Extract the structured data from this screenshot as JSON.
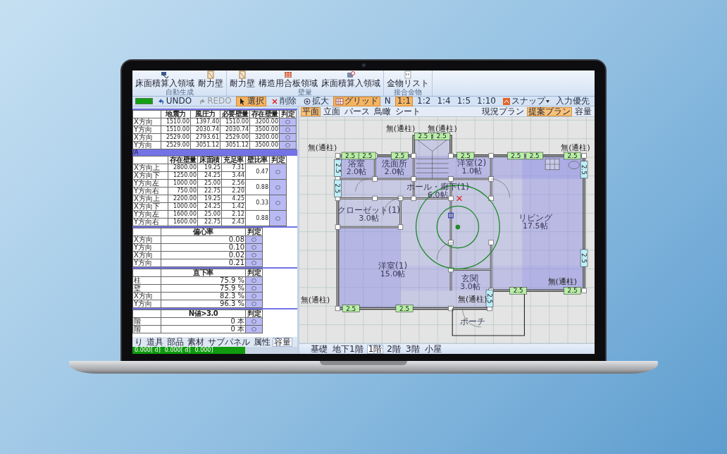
{
  "ribbon": {
    "groups": [
      {
        "label": "自動生成",
        "buttons": [
          {
            "label": "床面積算入領域"
          },
          {
            "label": "耐力壁"
          }
        ]
      },
      {
        "label": "壁量",
        "buttons": [
          {
            "label": "耐力壁"
          },
          {
            "label": "構造用合板領域"
          },
          {
            "label": "床面積算入領域"
          }
        ]
      },
      {
        "label": "接合金物",
        "buttons": [
          {
            "label": "金物リスト"
          }
        ]
      }
    ]
  },
  "toolbar": {
    "progress": {
      "level": 1
    },
    "items": [
      {
        "kind": "button",
        "label": "UNDO",
        "selected": false,
        "disabled": false
      },
      {
        "kind": "button",
        "label": "REDO",
        "selected": false,
        "disabled": true
      },
      {
        "kind": "button",
        "label": "選択",
        "selected": true,
        "disabled": false
      },
      {
        "kind": "button",
        "label": "削除",
        "selected": false,
        "disabled": false
      },
      {
        "kind": "button",
        "label": "拡大",
        "selected": false,
        "disabled": false
      },
      {
        "kind": "button",
        "label": "グリッド",
        "selected": true,
        "disabled": false
      },
      {
        "kind": "button",
        "label": "N",
        "selected": false,
        "disabled": false
      },
      {
        "kind": "button",
        "label": "1:1",
        "selected": true,
        "disabled": false
      },
      {
        "kind": "button",
        "label": "1:2",
        "selected": false,
        "disabled": false
      },
      {
        "kind": "button",
        "label": "1:4",
        "selected": false,
        "disabled": false
      },
      {
        "kind": "button",
        "label": "1:5",
        "selected": false,
        "disabled": false
      },
      {
        "kind": "button",
        "label": "1:10",
        "selected": false,
        "disabled": false
      },
      {
        "kind": "menu",
        "label": "スナップ",
        "selected": false,
        "disabled": false
      },
      {
        "kind": "button",
        "label": "入力優先",
        "selected": false,
        "disabled": false
      }
    ]
  },
  "check_panel": {
    "sections": [
      {
        "kind": "six",
        "columns": [
          "",
          "地震力",
          "風圧力",
          "必要壁量",
          "存在壁量",
          "判定"
        ],
        "rows": [
          {
            "cells": [
              "X方向",
              "1510.00",
              "1397.40",
              "1510.00",
              "3200.00",
              "○"
            ]
          },
          {
            "cells": [
              "Y方向",
              "1510.00",
              "2030.74",
              "2030.74",
              "3500.00",
              "○"
            ]
          },
          {
            "cells": [
              "X方向",
              "2529.00",
              "2793.61",
              "2529.00",
              "3200.00",
              "○"
            ]
          },
          {
            "cells": [
              "Y方向",
              "2529.00",
              "3051.12",
              "3051.12",
              "3500.00",
              "○"
            ]
          }
        ]
      },
      {
        "kind": "wall",
        "band": "/A",
        "columns": [
          "",
          "存在壁量",
          "床面積",
          "充足率",
          "壁比率",
          "判定"
        ],
        "rows": [
          {
            "cells": [
              "X方向上",
              "2800.00",
              "19.25",
              "7.31"
            ],
            "merged": [
              "0.47",
              "○"
            ]
          },
          {
            "cells": [
              "X方向下",
              "1250.00",
              "24.25",
              "3.44"
            ]
          },
          {
            "cells": [
              "Y方向左",
              "1000.00",
              "25.00",
              "2.56"
            ],
            "merged": [
              "0.88",
              "○"
            ]
          },
          {
            "cells": [
              "Y方向右",
              "750.00",
              "22.75",
              "2.20"
            ]
          },
          {
            "cells": [
              "X方向上",
              "2200.00",
              "19.25",
              "4.25"
            ],
            "merged": [
              "0.33",
              "○"
            ]
          },
          {
            "cells": [
              "X方向下",
              "1000.00",
              "24.25",
              "1.42"
            ]
          },
          {
            "cells": [
              "Y方向左",
              "1600.00",
              "25.00",
              "2.12"
            ],
            "merged": [
              "0.88",
              "○"
            ]
          },
          {
            "cells": [
              "Y方向右",
              "1600.00",
              "22.75",
              "2.43"
            ]
          }
        ]
      },
      {
        "kind": "three",
        "columns": [
          "",
          "偏心率",
          "判定"
        ],
        "rows": [
          {
            "cells": [
              "X方向",
              "0.08",
              "○"
            ]
          },
          {
            "cells": [
              "Y方向",
              "0.10",
              "○"
            ]
          },
          {
            "cells": [
              "X方向",
              "0.02",
              "○"
            ]
          },
          {
            "cells": [
              "Y方向",
              "0.21",
              "○"
            ]
          }
        ]
      },
      {
        "kind": "three",
        "columns": [
          "",
          "直下率",
          "判定"
        ],
        "rows": [
          {
            "cells": [
              "柱",
              "75.9 %",
              "○"
            ]
          },
          {
            "cells": [
              "壁",
              "75.9 %",
              "○"
            ]
          },
          {
            "cells": [
              "X方向",
              "82.3 %",
              "○"
            ]
          },
          {
            "cells": [
              "Y方向",
              "96.3 %",
              "○"
            ]
          }
        ]
      },
      {
        "kind": "three",
        "columns": [
          "",
          "N値>3.0",
          "判定"
        ],
        "rows": [
          {
            "cells": [
              "階",
              "0 本",
              "○"
            ]
          },
          {
            "cells": [
              "階",
              "0 本",
              "○"
            ]
          }
        ]
      }
    ]
  },
  "panel_tabs": [
    {
      "label": "り",
      "selected": false
    },
    {
      "label": "道具",
      "selected": false
    },
    {
      "label": "部品",
      "selected": false
    },
    {
      "label": "素材",
      "selected": false
    },
    {
      "label": "サブパネル",
      "selected": false
    },
    {
      "label": "属性",
      "selected": false
    },
    {
      "label": "容量",
      "selected": true
    }
  ],
  "status_bar": [
    "0.000[ d]",
    "0.000[ d]",
    "0.000]"
  ],
  "view_tabs": [
    {
      "label": "平面",
      "selected": true
    },
    {
      "label": "立面",
      "selected": false
    },
    {
      "label": "パース",
      "selected": false
    },
    {
      "label": "鳥瞰",
      "selected": false
    },
    {
      "label": "シート",
      "selected": false
    }
  ],
  "plan_tabs": [
    {
      "label": "現況プラン",
      "selected": false
    },
    {
      "label": "提案プラン",
      "selected": true
    },
    {
      "label": "容量",
      "selected": false
    }
  ],
  "plan": {
    "rooms": [
      {
        "name": "浴室",
        "area": "2.0帖"
      },
      {
        "name": "洗面所",
        "area": "2.0帖"
      },
      {
        "name": "洋室(2)",
        "area": "1.0帖"
      },
      {
        "name": "ホール・廊下(1)",
        "area": "6.0帖"
      },
      {
        "name": "クローゼット(1)",
        "area": "3.0帖"
      },
      {
        "name": "リビング",
        "area": "17.5帖"
      },
      {
        "name": "洋室(1)",
        "area": "15.0帖"
      },
      {
        "name": "玄関",
        "area": "3.0帖"
      },
      {
        "name": "ポーチ"
      }
    ],
    "post_labels": [
      "無(通柱)",
      "無(通柱)",
      "無(通柱)",
      "無(通柱)",
      "無(通柱)",
      "無(通柱)",
      "無(通柱)"
    ],
    "wall_panels": [
      "2.5",
      "2.5",
      "2.5",
      "2.5",
      "2.5",
      "2.5",
      "2.5",
      "2.5",
      "2.5",
      "2.5",
      "2.5",
      "2.5",
      "2.5",
      "2.5",
      "2.5",
      "2.5",
      "2.5",
      "2.5"
    ]
  },
  "floor_tabs": [
    {
      "label": "基礎",
      "selected": false
    },
    {
      "label": "地下1階",
      "selected": false
    },
    {
      "label": "1階",
      "selected": true
    },
    {
      "label": "2階",
      "selected": false
    },
    {
      "label": "3階",
      "selected": false
    },
    {
      "label": "小屋",
      "selected": false
    }
  ]
}
